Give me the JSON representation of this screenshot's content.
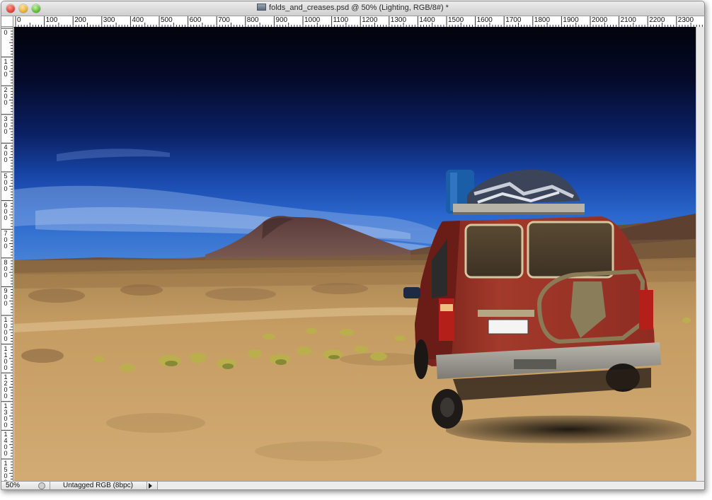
{
  "window": {
    "title": "folds_and_creases.psd @ 50% (Lighting, RGB/8#) *"
  },
  "ruler": {
    "horizontal_labels": [
      "0",
      "100",
      "200",
      "300",
      "400",
      "500",
      "600",
      "700",
      "800",
      "900",
      "1000",
      "1100",
      "1200",
      "1300",
      "1400",
      "1500",
      "1600",
      "1700",
      "1800",
      "1900",
      "2000",
      "2100",
      "2200",
      "2300"
    ],
    "vertical_labels": [
      "0",
      "100",
      "200",
      "300",
      "400",
      "500",
      "600",
      "700",
      "800",
      "900",
      "1000",
      "1100",
      "1200",
      "1300",
      "1400",
      "1500"
    ]
  },
  "status": {
    "zoom": "50%",
    "doc_info": "Untagged RGB (8bpc)"
  },
  "colors": {
    "sky_top": "#02040f",
    "sky_mid": "#0d2a7a",
    "sky_horizon": "#2f6bd1",
    "ground": "#c9a36a",
    "vehicle_body": "#9b2d23"
  }
}
